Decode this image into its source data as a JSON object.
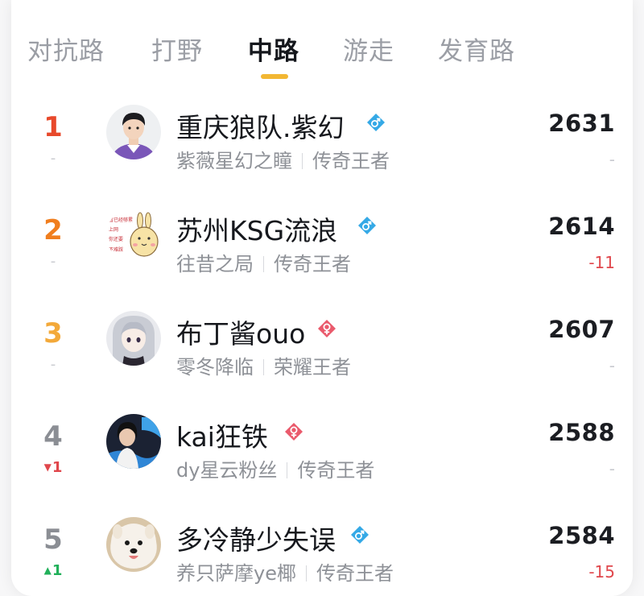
{
  "tabs": [
    {
      "label": "对抗路"
    },
    {
      "label": "打野"
    },
    {
      "label": "中路"
    },
    {
      "label": "游走"
    },
    {
      "label": "发育路"
    }
  ],
  "active_tab": "中路",
  "colors": {
    "accent": "#f2b733",
    "rank1": "#e8492b",
    "rank2": "#f07e1e",
    "rank3": "#f3a93a",
    "rank_other": "#8b8e94",
    "male_badge": "#35a9e6",
    "female_badge": "#ea5a6c",
    "drop": "#e0474c",
    "rise": "#21b05a"
  },
  "players": [
    {
      "rank": "1",
      "rank_change": "-",
      "rank_change_dir": "flat",
      "name": "重庆狼队.紫幻",
      "gender_icon": "male-icon",
      "title": "紫薇星幻之瞳",
      "tier": "传奇王者",
      "score": "2631",
      "score_change": "-"
    },
    {
      "rank": "2",
      "rank_change": "-",
      "rank_change_dir": "flat",
      "name": "苏州KSG流浪",
      "gender_icon": "male-icon",
      "title": "往昔之局",
      "tier": "传奇王者",
      "score": "2614",
      "score_change": "-11",
      "avatar_text": [
        "看已经够累",
        "上网",
        "你还要",
        "不难踩"
      ]
    },
    {
      "rank": "3",
      "rank_change": "-",
      "rank_change_dir": "flat",
      "name": "布丁酱ouo",
      "gender_icon": "female-icon",
      "title": "零冬降临",
      "tier": "荣耀王者",
      "score": "2607",
      "score_change": "-"
    },
    {
      "rank": "4",
      "rank_change": "1",
      "rank_change_dir": "down",
      "name": "kai狂铁",
      "gender_icon": "female-icon",
      "title": "dy星云粉丝",
      "tier": "传奇王者",
      "score": "2588",
      "score_change": "-"
    },
    {
      "rank": "5",
      "rank_change": "1",
      "rank_change_dir": "up",
      "name": "多冷静少失误",
      "gender_icon": "male-icon",
      "title": "养只萨摩ye椰",
      "tier": "传奇王者",
      "score": "2584",
      "score_change": "-15"
    }
  ]
}
